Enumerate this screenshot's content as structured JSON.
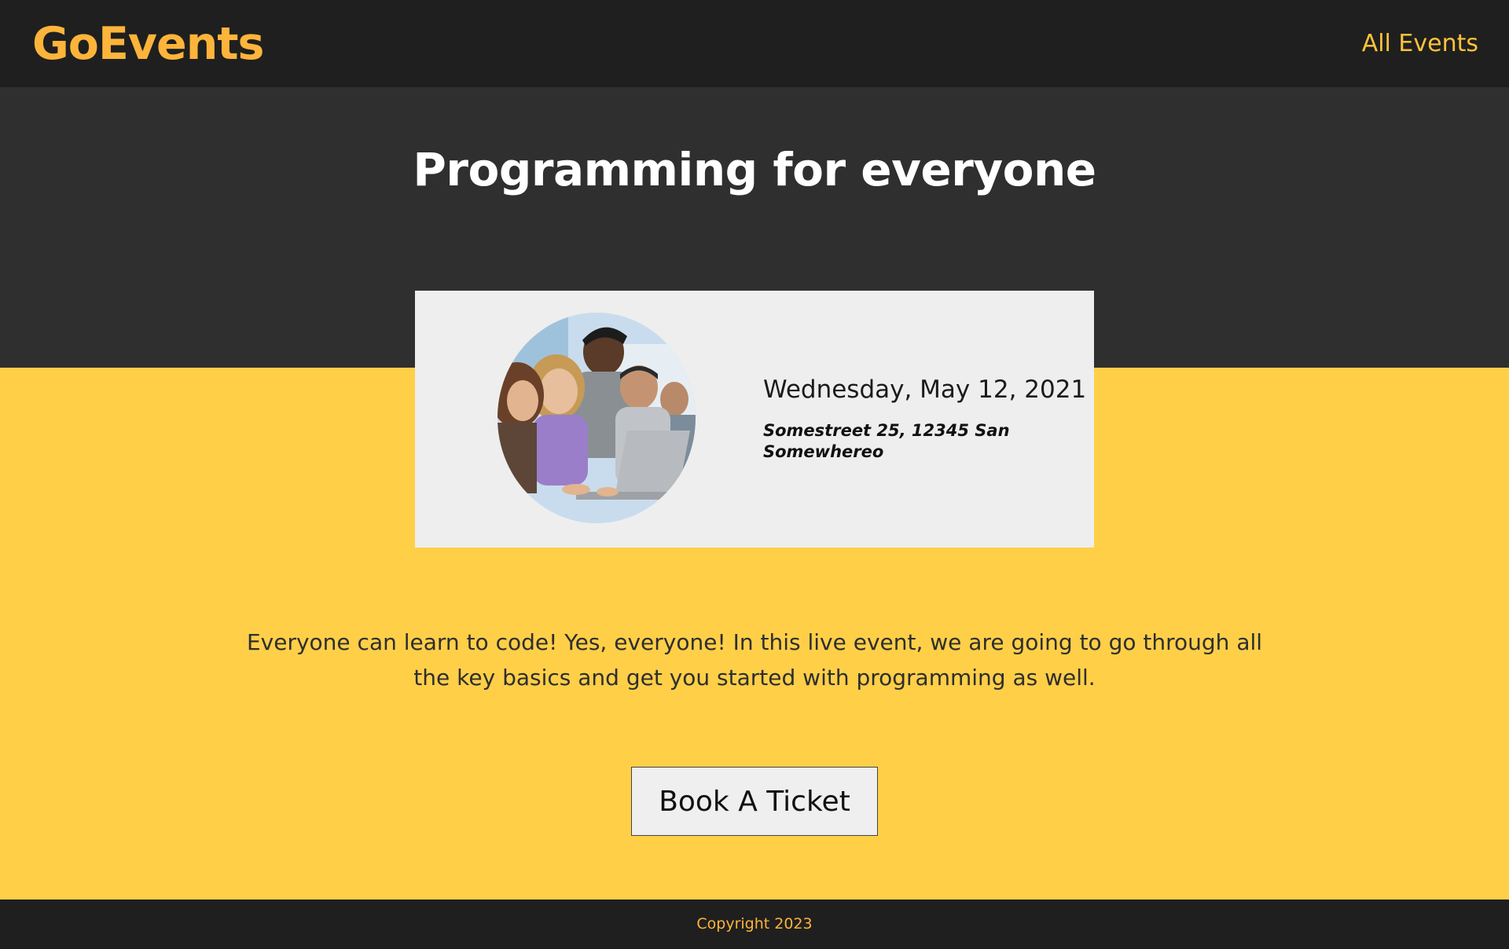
{
  "header": {
    "logo": "GoEvents",
    "nav": {
      "all_events": "All Events"
    }
  },
  "event": {
    "title": "Programming for everyone",
    "date": "Wednesday, May 12, 2021",
    "address": "Somestreet 25, 12345 San Somewhereo",
    "description": "Everyone can learn to code! Yes, everyone! In this live event, we are going to go through all the key basics and get you started with programming as well.",
    "book_label": "Book A Ticket"
  },
  "footer": {
    "copyright": "Copyright 2023"
  },
  "colors": {
    "header_bg": "#1f1f1f",
    "hero_bg": "#2f2f2f",
    "accent_yellow": "#ffcf48",
    "logo_orange": "#fdb43b",
    "card_bg": "#eeeeee"
  }
}
